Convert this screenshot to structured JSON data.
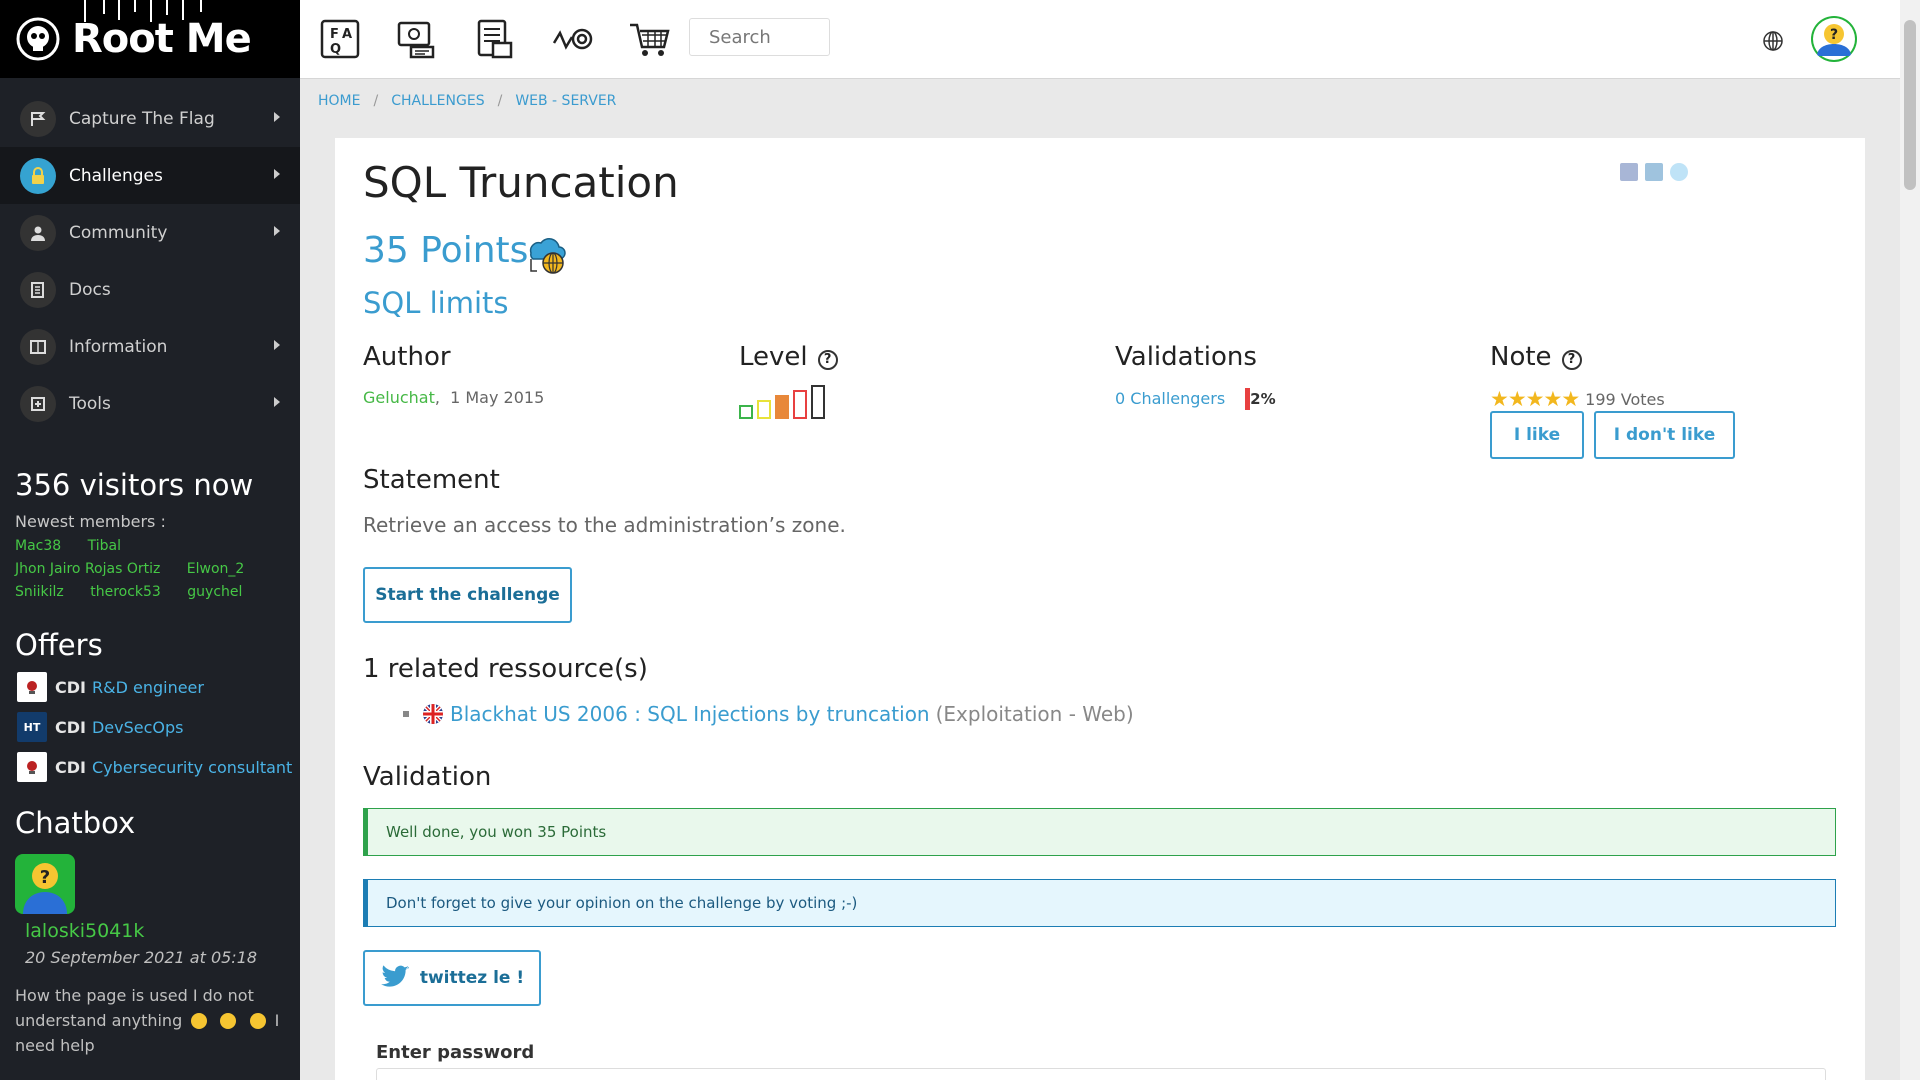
{
  "logo": {
    "text": "Root Me"
  },
  "sidebar": {
    "nav": [
      {
        "label": "Capture The Flag",
        "icon": "flag-icon",
        "caret": true,
        "active": false
      },
      {
        "label": "Challenges",
        "icon": "lock-icon",
        "caret": true,
        "active": true
      },
      {
        "label": "Community",
        "icon": "people-icon",
        "caret": true,
        "active": false
      },
      {
        "label": "Docs",
        "icon": "docs-icon",
        "caret": false,
        "active": false
      },
      {
        "label": "Information",
        "icon": "info-icon",
        "caret": true,
        "active": false
      },
      {
        "label": "Tools",
        "icon": "tools-icon",
        "caret": true,
        "active": false
      }
    ],
    "visitors": "356 visitors now",
    "newest_label": "Newest members :",
    "members": [
      "Mac38",
      "Tibal",
      "Jhon Jairo Rojas Ortiz",
      "Elwon_2",
      "Sniikilz",
      "therock53",
      "guychel"
    ],
    "offers_title": "Offers",
    "offers": [
      {
        "type": "CDI",
        "title": "R&D engineer"
      },
      {
        "type": "CDI",
        "title": "DevSecOps"
      },
      {
        "type": "CDI",
        "title": "Cybersecurity consultant"
      }
    ],
    "chatbox_title": "Chatbox",
    "chat": {
      "user": "laloski5041k",
      "date": "20 September 2021 at 05:18",
      "msg_part1": "How the page is used I do not understand anything",
      "msg_part2": "I need help"
    }
  },
  "topbar": {
    "search_placeholder": "Search",
    "icons": [
      "faq-icon",
      "learning-icon",
      "documents-icon",
      "target-icon",
      "shop-icon"
    ]
  },
  "breadcrumb": {
    "home": "HOME",
    "challenges": "CHALLENGES",
    "category": "WEB - SERVER",
    "sep": "/"
  },
  "challenge": {
    "title": "SQL Truncation",
    "points": "35 Points",
    "subtitle": "SQL limits",
    "author_h": "Author",
    "author": "Geluchat",
    "date": "1 May 2015",
    "level_h": "Level",
    "level_value": 4,
    "level_max": 5,
    "validations_h": "Validations",
    "challengers": "0 Challengers",
    "percent": "2%",
    "note_h": "Note",
    "stars": 5,
    "votes": "199 Votes",
    "like_label": "I like",
    "dislike_label": "I don't like",
    "statement_h": "Statement",
    "statement": "Retrieve an access to the administration’s zone.",
    "start_label": "Start the challenge",
    "resources_h": "1 related ressource(s)",
    "resource_title": "Blackhat US 2006 : SQL Injections by truncation",
    "resource_category": "(Exploitation - Web)",
    "validation_h": "Validation",
    "success_msg": "Well done, you won 35 Points",
    "info_msg": "Don't forget to give your opinion on the challenge by voting ;-)",
    "tweet_label": "twittez le !",
    "password_label": "Enter password"
  },
  "colors": {
    "accent": "#3a9ccf",
    "success": "#2ea24b",
    "member": "#46c846",
    "sidebar": "#1e2127"
  }
}
